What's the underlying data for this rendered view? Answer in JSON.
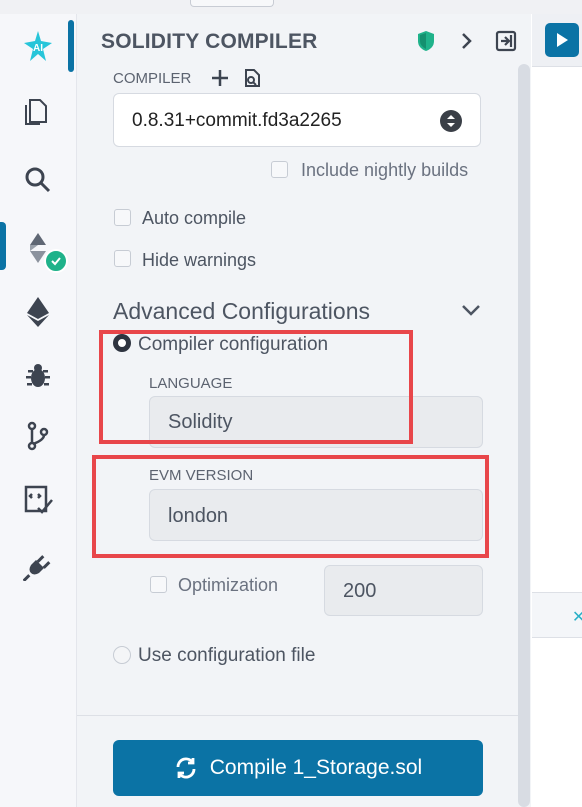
{
  "rail": {
    "items": [
      {
        "name": "ai-assistant",
        "label": "AI"
      },
      {
        "name": "file-explorer"
      },
      {
        "name": "search"
      },
      {
        "name": "solidity-compiler"
      },
      {
        "name": "deploy-run"
      },
      {
        "name": "debugger"
      },
      {
        "name": "git"
      },
      {
        "name": "testing"
      },
      {
        "name": "plugin-manager"
      }
    ],
    "accent": "#0b73a5",
    "ai_color": "#27c5d9",
    "badge_color": "#1fb28a"
  },
  "panel": {
    "title": "SOLIDITY COMPILER",
    "compiler_label": "COMPILER",
    "compiler_version": "0.8.31+commit.fd3a2265",
    "include_nightly_label": "Include nightly builds",
    "auto_compile_label": "Auto compile",
    "hide_warnings_label": "Hide warnings",
    "advanced_title": "Advanced Configurations",
    "compiler_config_label": "Compiler configuration",
    "language_label": "LANGUAGE",
    "language_value": "Solidity",
    "evm_label": "EVM VERSION",
    "evm_value": "london",
    "optimization_label": "Optimization",
    "optimization_runs": "200",
    "use_config_file_label": "Use configuration file",
    "compile_button_label": "Compile 1_Storage.sol"
  },
  "colors": {
    "primary": "#0b73a5",
    "highlight": "#e8464a",
    "shield": "#1fb28a"
  }
}
